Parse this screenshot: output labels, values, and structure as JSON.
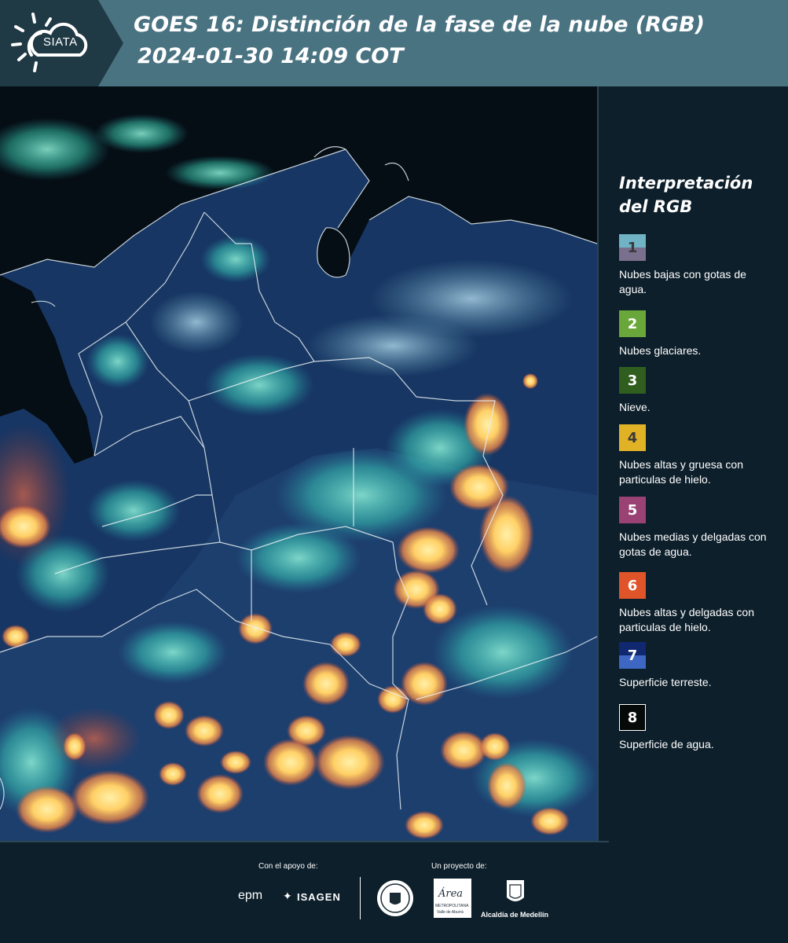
{
  "header": {
    "logo_text": "SIATA",
    "title_line1": "GOES 16: Distinción de la fase de la nube (RGB)",
    "title_line2": "2024-01-30 14:09 COT"
  },
  "map": {
    "description_icon": "satellite-rgb-map",
    "colors": {
      "ocean": "#050e14",
      "land": "#1d3f6e",
      "ice_cloud": "#ffd066",
      "water_cloud": "#3ee0c4"
    }
  },
  "legend": {
    "title": "Interpretación del RGB",
    "items": [
      {
        "number": "1",
        "label": "Nubes bajas con gotas de agua.",
        "color_top": "#6fb3c4",
        "color_bottom": "#7a6f8c"
      },
      {
        "number": "2",
        "label": "Nubes glaciares.",
        "color_top": "#6aa73a",
        "color_bottom": "#6aa73a"
      },
      {
        "number": "3",
        "label": "Nieve.",
        "color_top": "#2f5e1f",
        "color_bottom": "#2f5e1f"
      },
      {
        "number": "4",
        "label": "Nubes altas y gruesa con particulas de hielo.",
        "color_top": "#e2b226",
        "color_bottom": "#e2b226"
      },
      {
        "number": "5",
        "label": "Nubes medias y delgadas con gotas de agua.",
        "color_top": "#9a4274",
        "color_bottom": "#9a4274"
      },
      {
        "number": "6",
        "label": "Nubes altas y delgadas con particulas de hielo.",
        "color_top": "#e0542a",
        "color_bottom": "#e0542a"
      },
      {
        "number": "7",
        "label": "Superficie terreste.",
        "color_top": "#102870",
        "color_bottom": "#3d67c2"
      },
      {
        "number": "8",
        "label": "Superficie de agua.",
        "color_top": "#050a08",
        "color_bottom": "#050a08"
      }
    ]
  },
  "footer": {
    "support_label": "Con el apoyo de:",
    "project_label": "Un proyecto de:",
    "epm": "epm",
    "isagen": "ISAGEN",
    "area_metro": "Área",
    "area_metro_sub": "METROPOLITANA",
    "area_metro_sub2": "Valle de Aburrá",
    "alcaldia": "Alcaldía de Medellín"
  }
}
